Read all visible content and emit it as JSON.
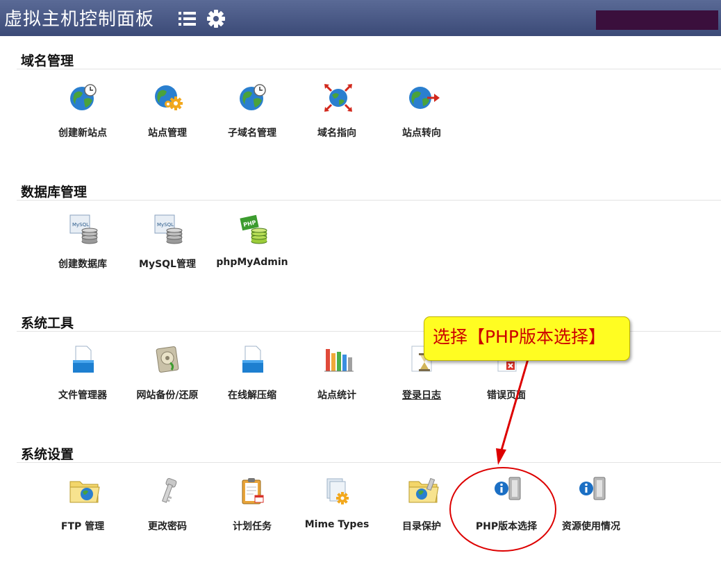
{
  "header": {
    "title": "虚拟主机控制面板",
    "menu_icon": "menu-icon",
    "settings_icon": "gear-icon",
    "account_box_color": "#3a0f3c"
  },
  "sections": [
    {
      "title": "域名管理",
      "items": [
        {
          "label": "创建新站点",
          "icon": "globe-clock-icon"
        },
        {
          "label": "站点管理",
          "icon": "globe-gear-icon"
        },
        {
          "label": "子域名管理",
          "icon": "globe-clock-icon"
        },
        {
          "label": "域名指向",
          "icon": "globe-arrows-icon"
        },
        {
          "label": "站点转向",
          "icon": "globe-arrow-icon"
        }
      ]
    },
    {
      "title": "数据库管理",
      "items": [
        {
          "label": "创建数据库",
          "icon": "mysql-db-icon"
        },
        {
          "label": "MySQL管理",
          "icon": "mysql-db-icon"
        },
        {
          "label": "phpMyAdmin",
          "icon": "php-db-icon"
        }
      ]
    },
    {
      "title": "系统工具",
      "items": [
        {
          "label": "文件管理器",
          "icon": "file-box-icon"
        },
        {
          "label": "网站备份/还原",
          "icon": "backup-disk-icon"
        },
        {
          "label": "在线解压缩",
          "icon": "file-box-icon"
        },
        {
          "label": "站点统计",
          "icon": "bar-chart-icon"
        },
        {
          "label": "登录日志",
          "icon": "log-hourglass-icon"
        },
        {
          "label": "错误页面",
          "icon": "error-page-icon"
        }
      ]
    },
    {
      "title": "系统设置",
      "items": [
        {
          "label": "FTP 管理",
          "icon": "folder-globe-icon"
        },
        {
          "label": "更改密码",
          "icon": "key-icon"
        },
        {
          "label": "计划任务",
          "icon": "clipboard-calendar-icon"
        },
        {
          "label": "Mime Types",
          "icon": "file-gear-icon"
        },
        {
          "label": "目录保护",
          "icon": "folder-globe-icon"
        },
        {
          "label": "PHP版本选择",
          "icon": "info-server-icon"
        },
        {
          "label": "资源使用情况",
          "icon": "info-server-icon"
        }
      ]
    }
  ],
  "annotation": {
    "callout_text": "选择【PHP版本选择】",
    "colors": {
      "callout_bg": "#fffd22",
      "callout_text": "#cc0000",
      "arrow": "#dd0000"
    }
  }
}
